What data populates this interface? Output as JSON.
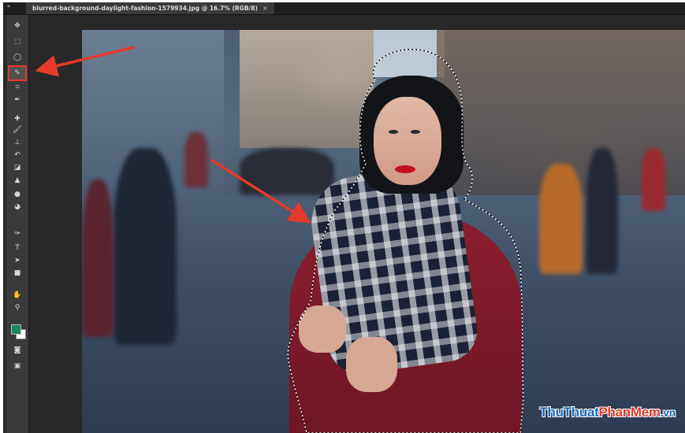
{
  "tab": {
    "title": "blurred-background-daylight-fashion-1579934.jpg @ 16.7% (RGB/8)",
    "close": "×"
  },
  "panel_toggle": "»",
  "toolbar": {
    "tools": [
      {
        "name": "move-tool",
        "icon": "move-icon",
        "glyph": "✥",
        "active": false
      },
      {
        "name": "marquee-tool",
        "icon": "marquee-icon",
        "glyph": "⬚",
        "active": false
      },
      {
        "name": "lasso-tool",
        "icon": "lasso-icon",
        "glyph": "◯",
        "active": false
      },
      {
        "name": "quick-selection-tool",
        "icon": "quick-selection-icon",
        "glyph": "✎",
        "active": true
      },
      {
        "name": "crop-tool",
        "icon": "crop-icon",
        "glyph": "⌗",
        "active": false
      },
      {
        "name": "eyedropper-tool",
        "icon": "eyedropper-icon",
        "glyph": "✒",
        "active": false
      },
      {
        "name": "healing-brush-tool",
        "icon": "bandage-icon",
        "glyph": "✚",
        "active": false
      },
      {
        "name": "brush-tool",
        "icon": "brush-icon",
        "glyph": "🖌",
        "active": false
      },
      {
        "name": "clone-stamp-tool",
        "icon": "stamp-icon",
        "glyph": "⊥",
        "active": false
      },
      {
        "name": "history-brush-tool",
        "icon": "history-brush-icon",
        "glyph": "↶",
        "active": false
      },
      {
        "name": "eraser-tool",
        "icon": "eraser-icon",
        "glyph": "◪",
        "active": false
      },
      {
        "name": "gradient-tool",
        "icon": "paint-bucket-icon",
        "glyph": "▲",
        "active": false
      },
      {
        "name": "blur-tool",
        "icon": "drop-icon",
        "glyph": "●",
        "active": false
      },
      {
        "name": "dodge-tool",
        "icon": "dodge-icon",
        "glyph": "◕",
        "active": false
      },
      {
        "name": "pen-tool",
        "icon": "pen-icon",
        "glyph": "✑",
        "active": false
      },
      {
        "name": "type-tool",
        "icon": "type-icon",
        "glyph": "T",
        "active": false
      },
      {
        "name": "path-selection-tool",
        "icon": "arrow-cursor-icon",
        "glyph": "➤",
        "active": false
      },
      {
        "name": "rectangle-tool",
        "icon": "rectangle-icon",
        "glyph": "■",
        "active": false
      },
      {
        "name": "hand-tool",
        "icon": "hand-icon",
        "glyph": "✋",
        "active": false
      },
      {
        "name": "zoom-tool",
        "icon": "zoom-icon",
        "glyph": "⚲",
        "active": false
      }
    ],
    "bottom": [
      {
        "name": "quick-mask-button",
        "icon": "quick-mask-icon",
        "glyph": "◙"
      },
      {
        "name": "screen-mode-button",
        "icon": "screen-mode-icon",
        "glyph": "▣"
      }
    ]
  },
  "colors": {
    "foreground": "#1a8a5a",
    "background": "#ffffff",
    "active_outline": "#e53a2b",
    "arrow": "#e53a2b"
  },
  "watermark": {
    "part1": "ThuThuat",
    "part2": "PhanMem",
    "part3": ".vn"
  }
}
